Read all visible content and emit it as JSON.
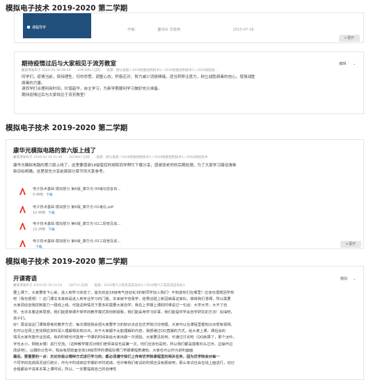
{
  "section1": {
    "title": "模拟电子技术 2019-2020 第二学期",
    "card0": {
      "book_cover_text": "课程导学",
      "author_label": "作者：",
      "author_name": "童诗白 华成英",
      "date": "2015-07-16",
      "expand_label": "展开"
    },
    "post1": {
      "title": "期待疫情过后与大家相见于流芳教室",
      "meta": {
        "author": "戴丽萍发布于 2020-02-18 08:35",
        "views": "109/396人已阅",
        "scope": "班级：默认班级 / 2018智能控制技术2 / 2018智能控制技术1 / 2018测控技…"
      },
      "edit_label": "编辑",
      "lines": [
        "同学们，疫情当前，保持理性，切勿恐慌，调整心态，积极应对，努力减少消极情绪，适当转移注意力，树立战胜病毒的信心，增强战胜",
        "病毒的力量。",
        "请同学们合理利用时间，珍惜韶华，自主学习，为新学期顺利学习做好充分准备。",
        "期待疫情过后与大家相见于流芳教室！"
      ]
    }
  },
  "section2": {
    "title": "模拟电子技术 2019-2020 第二学期",
    "post": {
      "title": "康华光模拟电路的第六版上线了",
      "meta": {
        "author": "戴丽萍发布于 2020-02-19 21:40",
        "views": "34/384人已阅",
        "scope": "班级：默认班级 / 2018智能控制技术2 / 2018智能控制技术1 / 2018测控技术"
      },
      "lines": [
        "康华光模拟电路的第六版上线了，这里要感谢18级智控的胡晖同学帮忙下载分享，感谢张老师的后期处理。为了大家学习路培清晰",
        "新目标明确，这里就先分享前面部分章节供大家参考。"
      ],
      "attachments": [
        {
          "name": "电子技术基础 模拟部分 第6版_康华光-00绪论前言目…",
          "size": "9.4MB",
          "download": "下载"
        },
        {
          "name": "电子技术基础 模拟部分 第6版_康华光-01绪论.pdf",
          "size": "10.4MB",
          "download": "下载"
        },
        {
          "name": "电子技术基础 模拟部分 第6版_康华光-02二极管及其…",
          "size": "23.2MB",
          "download": "下载"
        },
        {
          "name": "电子技术基础 模拟部分 第6版_康华光-03三极管及其…",
          "size": "",
          "download": "下载"
        }
      ],
      "expand_label": "展开"
    }
  },
  "section3": {
    "title": "模拟电子技术 2019-2020 第二学期",
    "post": {
      "title": "开课寄语",
      "meta": {
        "author": "戴丽萍发布于 2020-02-19 12:52",
        "views": "28/72人已阅",
        "scope": "班级：2018电气工程及其自动化4 / 2018电气工程及其自动化3"
      },
      "edit_label": "删除",
      "lines": [
        "要上课了，大家要安下心来，进入到学习状态了。首先欢迎18级电气自动化3的新同学加入我们！不知道你们在哪里？应该也很想回学校",
        "吧（我也很想）！这门课文本来就是进入到专业学习的门槛，本来就不容易学，结果还碰上新冠病毒这家伙，搞得我们滞课，所以需要",
        "大家调动自我控制能力一碰线上线。可能这种情况下更多的需要大家自学，我在上学期上课的时候说过一句话：大学大学，大不了自",
        "学。也许本着这种思想，我们能把停课不停学的教学模式贯彻到极致，我们能采用学习好事，我们能提供学会自学研究的方法！加油吧，",
        "孩子们。",
        "好！再说说这门课我想考的教学方式：每次课前我会把大家要学习的知识点这在优学院讨论吧题，大家可以在课程里看知识点很有视频，",
        "也可以在网上查找相应资料深入理解相关知识点，对于大家都不太能理解的内容，我想通过QQ直播的方式，给大家上课。课后会的",
        "情况大家布置作业完成。有的时候也可能用一节课的时间来给大家出做一次测验。大家要见如何，可通过讨论吧（QQ就算了，那个太吵，",
        "字也太小，网络太慢）进行交流。（这种教学模式对我们老师来说也是第一次，你们应该也是吧，所以我们都是摸着石头过河，边操作边",
        "改进吧）。以期的公告中，我会有把前面全体18级同学的课程在哪门学期课程表通知，大家也可以作为讲利面面",
        "最后，要重要的一点：无论你是以哪种方式进行学习的，都必须遵守我们上传到优学院课程里的相关任务，因为优学院会对每一",
        "个同学的完成情况进行统计，作为平时成绩这学期的平时成绩，也许等我们考试的时候还没有那就吧，那么考试也会在线上面进行，切记",
        "全程都会不进来本事上课时间，所以，一定要提高自己的自律性"
      ]
    }
  }
}
